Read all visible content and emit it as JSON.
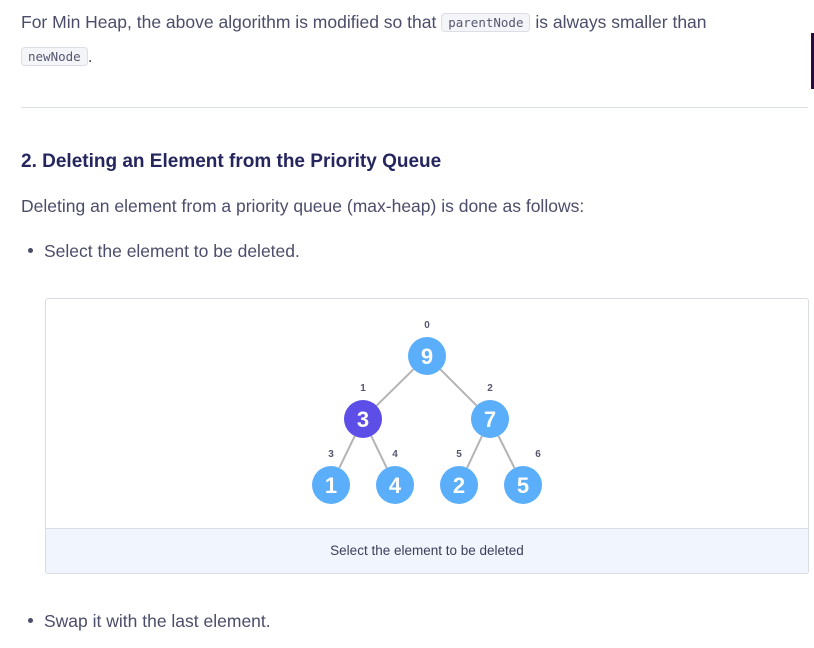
{
  "intro": {
    "text_1": "For Min Heap, the above algorithm is modified so that ",
    "code_1": "parentNode",
    "text_2": " is always smaller than",
    "code_2": "newNode",
    "text_3": "."
  },
  "section": {
    "title": "2. Deleting an Element from the Priority Queue",
    "description": "Deleting an element from a priority queue (max-heap) is done as follows:",
    "steps": [
      "Select the element to be deleted.",
      "Swap it with the last element."
    ]
  },
  "figure": {
    "caption": "Select the element to be deleted",
    "colors": {
      "node": "#5aaefa",
      "selected_node": "#5c4ee6",
      "edge": "#b4b4b4",
      "caption_bg": "#f1f5fd"
    },
    "nodes": [
      {
        "index": "0",
        "value": "9",
        "selected": false
      },
      {
        "index": "1",
        "value": "3",
        "selected": true
      },
      {
        "index": "2",
        "value": "7",
        "selected": false
      },
      {
        "index": "3",
        "value": "1",
        "selected": false
      },
      {
        "index": "4",
        "value": "4",
        "selected": false
      },
      {
        "index": "5",
        "value": "2",
        "selected": false
      },
      {
        "index": "6",
        "value": "5",
        "selected": false
      }
    ]
  }
}
